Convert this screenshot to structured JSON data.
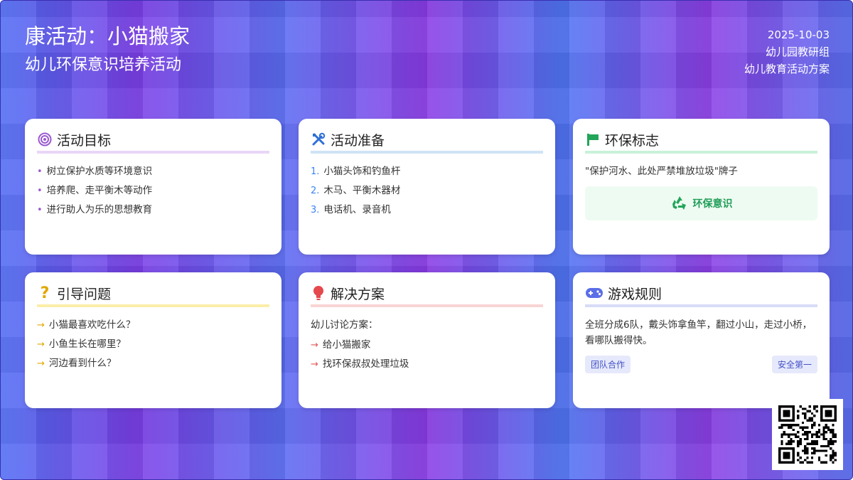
{
  "header": {
    "title": "康活动：小猫搬家",
    "subtitle": "幼儿环保意识培养活动",
    "date": "2025-10-03",
    "org": "幼儿园教研组",
    "category": "幼儿教育活动方案"
  },
  "cards": {
    "goals": {
      "title": "活动目标",
      "icon": "target-icon",
      "items": [
        "树立保护水质等环境意识",
        "培养爬、走平衡木等动作",
        "进行助人为乐的思想教育"
      ]
    },
    "prep": {
      "title": "活动准备",
      "icon": "tools-icon",
      "items": [
        "小猫头饰和钓鱼杆",
        "木马、平衡木器材",
        "电话机、录音机"
      ]
    },
    "sign": {
      "title": "环保标志",
      "icon": "flag-icon",
      "text": "\"保护河水、此处严禁堆放垃圾\"牌子",
      "badge": "环保意识",
      "badge_icon": "recycle-icon"
    },
    "questions": {
      "title": "引导问题",
      "icon": "question-icon",
      "items": [
        "小猫最喜欢吃什么？",
        "小鱼生长在哪里？",
        "河边看到什么？"
      ]
    },
    "solutions": {
      "title": "解决方案",
      "icon": "lightbulb-icon",
      "intro": "幼儿讨论方案：",
      "items": [
        "给小猫搬家",
        "找环保叔叔处理垃圾"
      ]
    },
    "rules": {
      "title": "游戏规则",
      "icon": "gamepad-icon",
      "text": "全班分成6队，戴头饰拿鱼竿，翻过小山，走过小桥，看哪队搬得快。",
      "tags": [
        "团队合作",
        "安全第一"
      ]
    }
  },
  "colors": {
    "purple": "#9b59d0",
    "blue": "#3b82f6",
    "green": "#22c55e",
    "yellow": "#e0a800",
    "red": "#e25555",
    "indigo": "#5b6ee8"
  }
}
